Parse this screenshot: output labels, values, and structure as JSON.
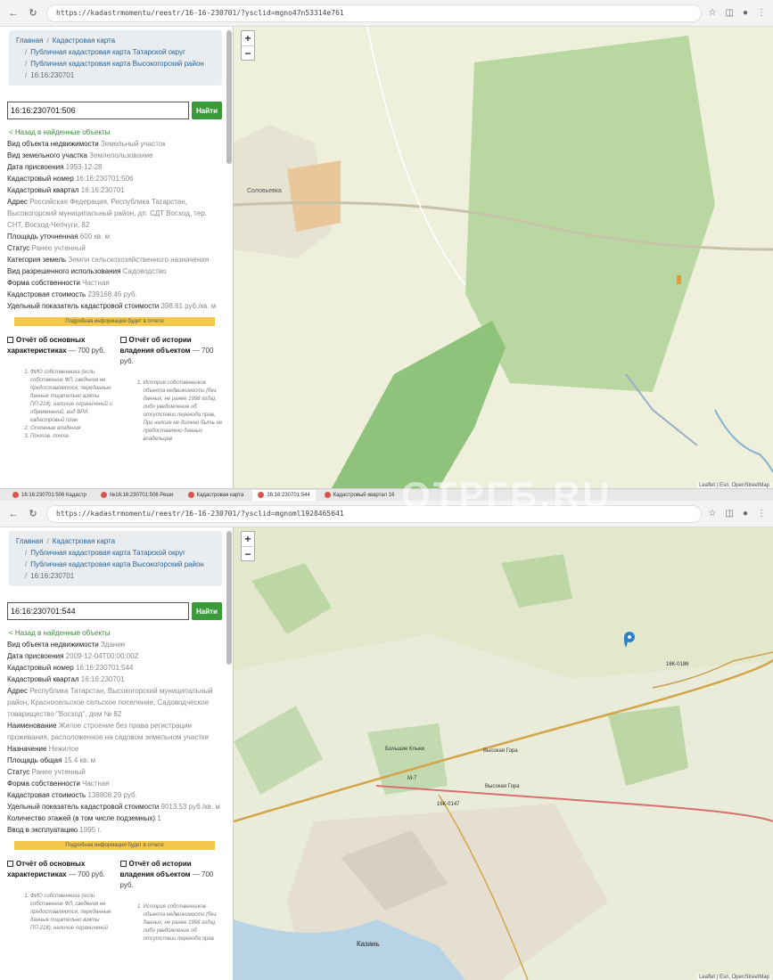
{
  "watermark": "ОТРГБ.RU",
  "top": {
    "url": "https://kadastrmomentu/reestr/16-16-230701/?ysclid=mgno47n53314e761",
    "breadcrumbs": [
      {
        "label": "Главная"
      },
      {
        "label": "Кадастровая карта"
      },
      {
        "label": "Публичная кадастровая карта Татарской округ"
      },
      {
        "label": "Публичная кадастровая карта Высокогорский район"
      },
      {
        "label": "16:16:230701"
      }
    ],
    "search": {
      "value": "16:16:230701:506",
      "button": "Найти"
    },
    "back_link": "< Назад в найденные объекты",
    "properties": [
      {
        "key": "Вид объекта недвижимости",
        "value": "Земельный участок"
      },
      {
        "key": "Вид земельного участка",
        "value": "Землепользование"
      },
      {
        "key": "Дата присвоения",
        "value": "1993-12-28"
      },
      {
        "key": "Кадастровый номер",
        "value": "16:16:230701:506"
      },
      {
        "key": "Кадастровый квартал",
        "value": "16:16:230701"
      },
      {
        "key": "Адрес",
        "value": "Российская Федерация, Республика Татарстан, Высокогорский муниципальный район, дп. СДТ Восход, тер. СНТ, Восход-Чепчуги, 82"
      },
      {
        "key": "Площадь уточненная",
        "value": "600 кв. м"
      },
      {
        "key": "Статус",
        "value": "Ранее учтенный"
      },
      {
        "key": "Категория земель",
        "value": "Земли сельскохозяйственного назначения"
      },
      {
        "key": "Вид разрешенного использования",
        "value": "Садоводство"
      },
      {
        "key": "Форма собственности",
        "value": "Частная"
      },
      {
        "key": "Кадастровая стоимость",
        "value": "239168.46 руб."
      },
      {
        "key": "Удельный показатель кадастровой стоимости",
        "value": "398.61 руб./кв. м"
      }
    ],
    "notice": "Подробная информация будет в отчете",
    "reports": [
      {
        "title": "Отчёт об основных характеристиках",
        "price": "— 700 руб.",
        "desc": [
          "ФИО собственника (если собственник ФЛ, сведения не предоставляются, переданные данные тщательно взяты ПП-218), наличие ограничений и обременений, вид ВРИ, кадастровый план",
          "Основные владения",
          "Почтов. почта"
        ]
      },
      {
        "title": "Отчёт об истории владения объектом",
        "price": "— 700 руб.",
        "desc": [
          "История собственников объекта недвижимости (без данных, не ранее 1998 года), либо уведомление об отсутствии перехода прав, При налоге не должно быть не предоставлено данных владельцев"
        ]
      }
    ],
    "map": {
      "attribution": "Leaflet | Esri, OpenStreetMap",
      "place_label": "Соловьевка"
    }
  },
  "taskbar": {
    "tabs": [
      {
        "label": "16:16:230701:506 Кадастр"
      },
      {
        "label": "№16:16:230701:506 Реши"
      },
      {
        "label": "Кадастровая карта"
      },
      {
        "label": "16:16:230701:544"
      },
      {
        "label": "Кадастровый квартал 16"
      }
    ]
  },
  "bottom": {
    "url": "https://kadastrmomentu/reestr/16-16-230701/?ysclid=mgnoml1928465641",
    "breadcrumbs": [
      {
        "label": "Главная"
      },
      {
        "label": "Кадастровая карта"
      },
      {
        "label": "Публичная кадастровая карта Татарской округ"
      },
      {
        "label": "Публичная кадастровая карта Высокогорский район"
      },
      {
        "label": "16:16:230701"
      }
    ],
    "search": {
      "value": "16:16:230701:544",
      "button": "Найти"
    },
    "back_link": "< Назад в найденные объекты",
    "properties": [
      {
        "key": "Вид объекта недвижимости",
        "value": "Здание"
      },
      {
        "key": "Дата присвоения",
        "value": "2009-12-04T00:00:00Z"
      },
      {
        "key": "Кадастровый номер",
        "value": "16:16:230701:544"
      },
      {
        "key": "Кадастровый квартал",
        "value": "16:16:230701"
      },
      {
        "key": "Адрес",
        "value": "Республика Татарстан, Высокогорский муниципальный район, Красносельское сельское поселение, Садоводческое товарищество \"Восход\", дом № 82"
      },
      {
        "key": "Наименование",
        "value": "Жилое строение без права регистрации проживания, расположенное на садовом земельном участке"
      },
      {
        "key": "Назначение",
        "value": "Нежилое"
      },
      {
        "key": "Площадь общая",
        "value": "15.4 кв. м"
      },
      {
        "key": "Статус",
        "value": "Ранее учтенный"
      },
      {
        "key": "Форма собственности",
        "value": "Частная"
      },
      {
        "key": "Кадастровая стоимость",
        "value": "138808.29 руб."
      },
      {
        "key": "Удельный показатель кадастровой стоимости",
        "value": "9013.53 руб./кв. м"
      },
      {
        "key": "Количество этажей (в том числе подземных)",
        "value": "1"
      },
      {
        "key": "Ввод в эксплуатацию",
        "value": "1995 г."
      }
    ],
    "notice": "Подробная информация будет в отчете",
    "reports": [
      {
        "title": "Отчёт об основных характеристиках",
        "price": "— 700 руб.",
        "desc": [
          "ФИО собственника (если собственник ФЛ, сведения не предоставляются, переданные данные тщательно взяты ПП-218), наличие ограничений"
        ]
      },
      {
        "title": "Отчёт об истории владения объектом",
        "price": "— 700 руб.",
        "desc": [
          "История собственников объекта недвижимости (без данных, не ранее 1998 года), либо уведомление об отсутствии перехода прав"
        ]
      }
    ],
    "map": {
      "labels": {
        "m7": "M-7",
        "r239": "16К-0147",
        "road": "16К-0186",
        "kazan": "Казань",
        "vysokaya_gora": "Высокая Гора",
        "vysokaya_gora2": "Высокая Гора",
        "inset": "Большие Клыки"
      },
      "attribution": "Leaflet | Esri, OpenStreetMap"
    }
  }
}
